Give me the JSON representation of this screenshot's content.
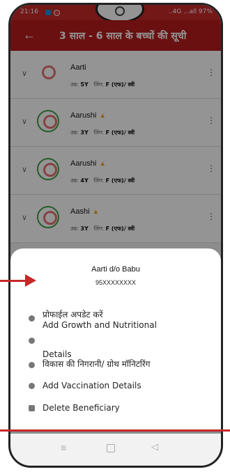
{
  "status_bar": {
    "time": "21:16",
    "right": "..4G ...all 97%"
  },
  "app_bar": {
    "title": "3 साल - 6 साल के बच्चों की सूची"
  },
  "beneficiaries": [
    {
      "name": "Aarti",
      "age_label": "उम्र:",
      "age": "5Y",
      "gender_label": "लिंग:",
      "gender": "F (एफ)/ स्त्री",
      "warning": false
    },
    {
      "name": "Aarushi",
      "age_label": "उम्र:",
      "age": "3Y",
      "gender_label": "लिंग:",
      "gender": "F (एफ)/ स्त्री",
      "warning": true
    },
    {
      "name": "Aarushi",
      "age_label": "उम्र:",
      "age": "4Y",
      "gender_label": "लिंग:",
      "gender": "F (एफ)/ स्त्री",
      "warning": true
    },
    {
      "name": "Aashi",
      "age_label": "उम्र:",
      "age": "3Y",
      "gender_label": "लिंग:",
      "gender": "F (एफ)/ स्त्री",
      "warning": true
    }
  ],
  "sheet": {
    "title": "Aarti d/o Babu",
    "subtitle": "95XXXXXXXX",
    "options": {
      "update_profile": "प्रोफाईल अपडेट करें",
      "add_growth": "Add Growth and Nutritional",
      "details": "Details",
      "growth_monitoring": "विकास की निगरानी/ ग्रोथ मॉनिटरिंग",
      "add_vaccination": "Add Vaccination Details",
      "delete": "Delete Beneficiary"
    }
  },
  "colors": {
    "app_bar": "#b71c1c",
    "status_bar": "#c62828",
    "annotation": "#c62828",
    "avatar_ring": "#43a047",
    "warning": "#f9a825"
  }
}
